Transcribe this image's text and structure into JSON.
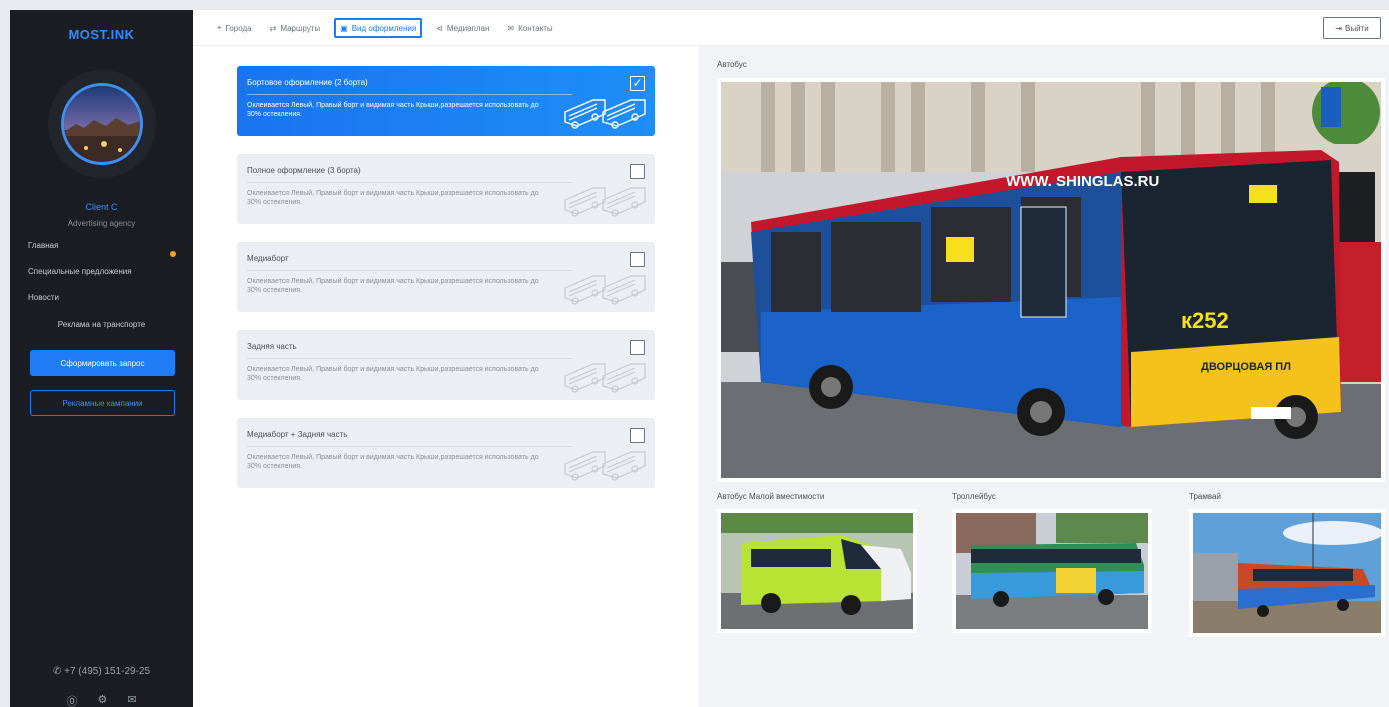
{
  "sidebar": {
    "logo": "MOST.INK",
    "client_name": "Client C",
    "client_role": "Advertising agency",
    "nav": [
      "Главная",
      "Специальные предложения",
      "Новости"
    ],
    "sub_nav": "Реклама на транспорте",
    "primary_button": "Сформировать запрос",
    "secondary_button": "Рекламные кампании",
    "phone": "+7 (495) 151-29-25"
  },
  "topbar": {
    "tabs": [
      "Города",
      "Маршруты",
      "Вид оформления",
      "Медиаплан",
      "Контакты"
    ],
    "active_tab": "Вид оформления",
    "logout": "Выйти"
  },
  "options": [
    {
      "title": "Бортовое оформление (2 борта)",
      "desc": "Оклеивается Левый, Правый борт и видимая часть Крыши,разрешается использовать до 30% остекления.",
      "checked": true
    },
    {
      "title": "Полное оформление (3 борта)",
      "desc": "Оклеивается Левый, Правый борт и видимая часть Крыши,разрешается использовать до 30% остекления.",
      "checked": false
    },
    {
      "title": "Медиаборт",
      "desc": "Оклеивается Левый, Правый борт и видимая часть Крыши,разрешается использовать до 30% остекления.",
      "checked": false
    },
    {
      "title": "Задняя часть",
      "desc": "Оклеивается Левый, Правый борт и видимая часть Крыши,разрешается использовать до 30% остекления.",
      "checked": false
    },
    {
      "title": "Медиаборт + Задняя часть",
      "desc": "Оклеивается Левый, Правый борт и видимая часть Крыши,разрешается использовать до 30% остекления.",
      "checked": false
    }
  ],
  "preview": {
    "main_label": "Автобус",
    "bus_site": "WWW. SHINGLAS.RU",
    "bus_route": "к252",
    "bus_dest": "ДВОРЦОВАЯ ПЛ",
    "thumbs": [
      "Автобус Малой вместимости",
      "Троллейбус",
      "Трамвай"
    ]
  },
  "colors": {
    "accent": "#1f7cf4",
    "sidebar": "#1b1d22",
    "dot": "#f5a524",
    "bus_red": "#c3182c",
    "bus_yellow": "#f4c21b"
  }
}
